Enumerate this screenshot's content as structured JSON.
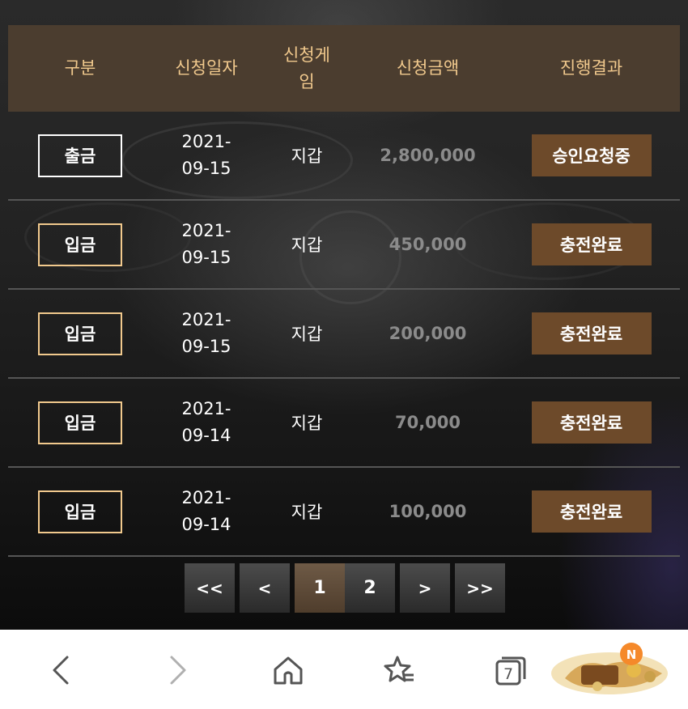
{
  "table": {
    "headers": [
      "구분",
      "신청일자",
      "신청게임",
      "신청금액",
      "진행결과"
    ],
    "rows": [
      {
        "type": "출금",
        "date": "2021-09-15",
        "game": "지갑",
        "amount": "2,800,000",
        "status": "승인요청중"
      },
      {
        "type": "입금",
        "date": "2021-09-15",
        "game": "지갑",
        "amount": "450,000",
        "status": "충전완료"
      },
      {
        "type": "입금",
        "date": "2021-09-15",
        "game": "지갑",
        "amount": "200,000",
        "status": "충전완료"
      },
      {
        "type": "입금",
        "date": "2021-09-14",
        "game": "지갑",
        "amount": "70,000",
        "status": "충전완료"
      },
      {
        "type": "입금",
        "date": "2021-09-14",
        "game": "지갑",
        "amount": "100,000",
        "status": "충전완료"
      }
    ]
  },
  "pagination": {
    "first": "<<",
    "prev": "<",
    "pages": [
      "1",
      "2"
    ],
    "current": "1",
    "next": ">",
    "last": ">>"
  },
  "browser": {
    "tab_count": "7",
    "ad_badge": "N"
  },
  "colors": {
    "header_bg": "#4b3d2f",
    "header_text": "#f1c98d",
    "status_bg": "#6d4a2a",
    "amount_text": "#8b8b8b"
  }
}
